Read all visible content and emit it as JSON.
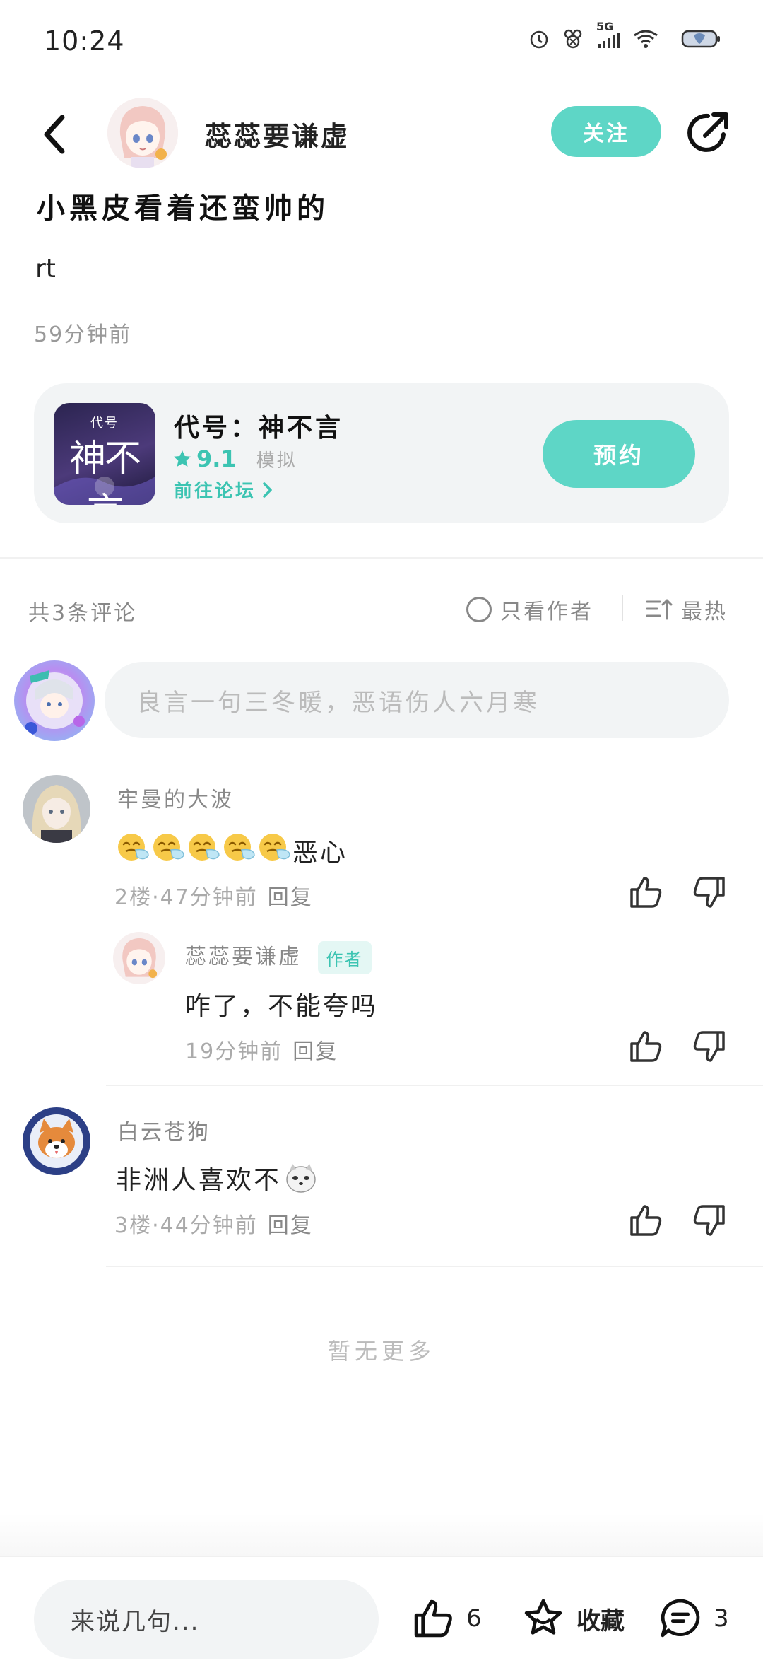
{
  "status_bar": {
    "time": "10:24",
    "network": "5G"
  },
  "header": {
    "author_name": "蕊蕊要谦虚",
    "follow_label": "关注"
  },
  "post": {
    "title": "小黑皮看着还蛮帅的",
    "body": "rt",
    "time": "59分钟前"
  },
  "game_card": {
    "cover_top": "代号",
    "cover_main": "神不言",
    "title": "代号：神不言",
    "rating": "9.1",
    "tag": "模拟",
    "forum_link": "前往论坛",
    "reserve_label": "预约",
    "accent_color": "#5ed6c6"
  },
  "comments_bar": {
    "count_label": "共3条评论",
    "only_author_label": "只看作者",
    "sort_label": "最热"
  },
  "compose": {
    "placeholder": "良言一句三冬暖，恶语伤人六月寒"
  },
  "comments": [
    {
      "author": "牢曼的大波",
      "text": "恶心",
      "emoji_count": 5,
      "floor_time": "2楼·47分钟前",
      "reply_label": "回复"
    },
    {
      "author": "蕊蕊要谦虚",
      "badge": "作者",
      "text": "咋了，不能夸吗",
      "time": "19分钟前",
      "reply_label": "回复"
    },
    {
      "author": "白云苍狗",
      "text": "非洲人喜欢不",
      "floor_time": "3楼·44分钟前",
      "reply_label": "回复"
    }
  ],
  "no_more_label": "暂无更多",
  "bottom_bar": {
    "input_placeholder": "来说几句...",
    "like_count": "6",
    "favorite_label": "收藏",
    "comment_count": "3"
  }
}
